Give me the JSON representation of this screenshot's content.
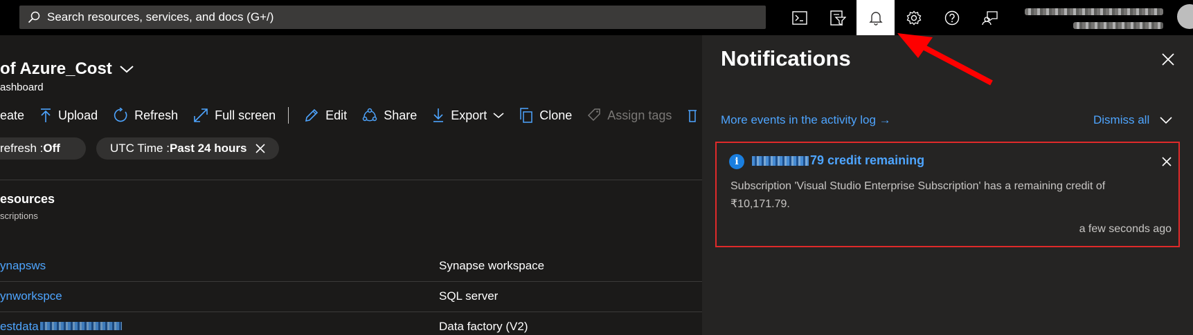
{
  "topbar": {
    "search_placeholder": "Search resources, services, and docs (G+/)",
    "icons": [
      "cloud-shell-icon",
      "directory-filter-icon",
      "notifications-bell-icon",
      "settings-gear-icon",
      "help-icon",
      "feedback-icon"
    ],
    "active_icon": "notifications-bell-icon"
  },
  "dashboard": {
    "title": "of Azure_Cost",
    "subtitle": "ashboard",
    "commands": {
      "create": "eate",
      "upload": "Upload",
      "refresh": "Refresh",
      "fullscreen": "Full screen",
      "edit": "Edit",
      "share": "Share",
      "export": "Export",
      "clone": "Clone",
      "assign_tags": "Assign tags"
    },
    "filters": {
      "autorefresh_prefix": "refresh : ",
      "autorefresh_value": "Off",
      "time_prefix": "UTC Time : ",
      "time_value": "Past 24 hours"
    },
    "section_title": "esources",
    "section_sub": "scriptions",
    "resources": [
      {
        "name": "ynapsws",
        "type": "Synapse workspace"
      },
      {
        "name": "ynworkspce",
        "type": "SQL server"
      },
      {
        "name": "estdata",
        "type": "Data factory (V2)"
      }
    ]
  },
  "notifications": {
    "title": "Notifications",
    "activity_link": "More events in the activity log →",
    "dismiss_all": "Dismiss all",
    "card": {
      "title_suffix": "79 credit remaining",
      "body": "Subscription 'Visual Studio Enterprise Subscription' has a remaining credit of ₹10,171.79.",
      "time": "a few seconds ago",
      "icon": "info-icon"
    }
  },
  "colors": {
    "background": "#1b1a19",
    "topbar": "#000000",
    "link": "#4ea5ff",
    "panel": "#252423",
    "highlight_border": "#e02a2a"
  }
}
